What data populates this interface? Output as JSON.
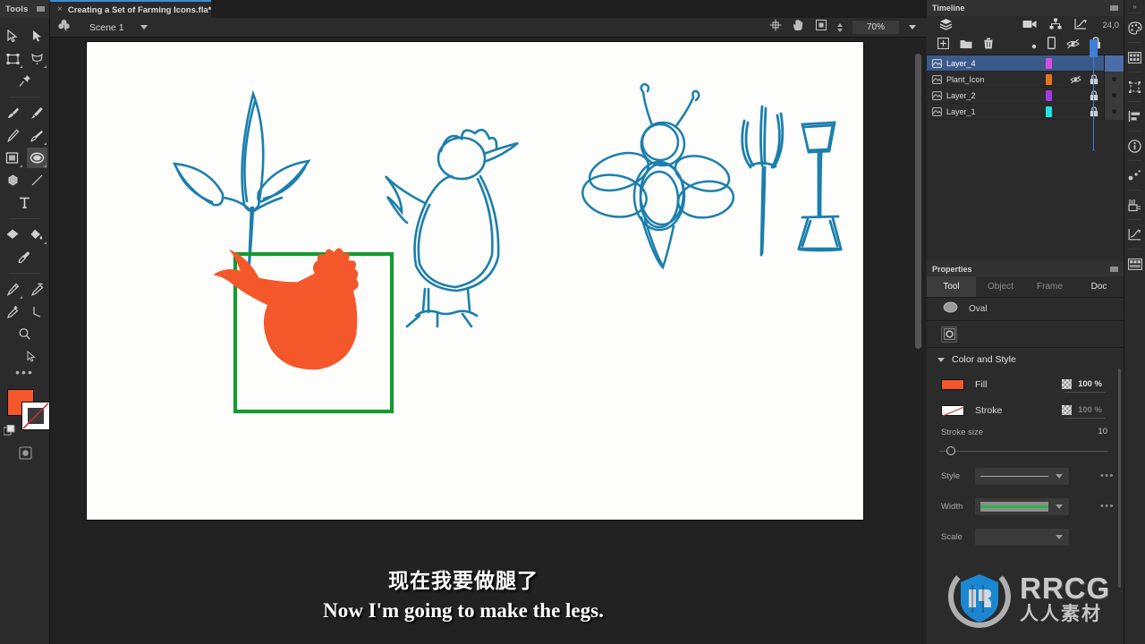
{
  "tools": {
    "title": "Tools",
    "menu_icon": "panel-menu-icon",
    "items": [
      {
        "name": "selection-tool",
        "icon": "arrow-outline-icon"
      },
      {
        "name": "subselection-tool",
        "icon": "arrow-filled-icon"
      },
      {
        "name": "free-transform-tool",
        "icon": "free-transform-icon"
      },
      {
        "name": "lasso-tool",
        "icon": "lasso-icon"
      },
      {
        "name": "pin-tool",
        "icon": "pin-icon"
      },
      {
        "name": "brush-tool",
        "icon": "paint-brush-icon"
      },
      {
        "name": "paint-brush-tool",
        "icon": "brush-icon"
      },
      {
        "name": "pencil-tool",
        "icon": "pencil-icon"
      },
      {
        "name": "fluid-brush-tool",
        "icon": "fluid-brush-icon"
      },
      {
        "name": "rectangle-tool",
        "icon": "rectangle-icon"
      },
      {
        "name": "oval-tool",
        "icon": "oval-icon"
      },
      {
        "name": "polystar-tool",
        "icon": "polygon-icon"
      },
      {
        "name": "line-tool",
        "icon": "line-icon"
      },
      {
        "name": "text-tool",
        "icon": "text-t-icon"
      },
      {
        "name": "eraser-tool",
        "icon": "eraser-icon"
      },
      {
        "name": "paint-bucket-tool",
        "icon": "paint-bucket-icon"
      },
      {
        "name": "eyedropper-tool",
        "icon": "eyedropper-icon"
      },
      {
        "name": "pen-tool",
        "icon": "pen-icon"
      },
      {
        "name": "delete-anchor-tool",
        "icon": "pen-minus-icon"
      },
      {
        "name": "add-anchor-tool",
        "icon": "pen-plus-icon"
      },
      {
        "name": "convert-anchor-tool",
        "icon": "convert-anchor-icon"
      },
      {
        "name": "zoom-tool",
        "icon": "magnifier-icon"
      },
      {
        "name": "hand-cursor-tool",
        "icon": "cursor-arrow-icon"
      }
    ],
    "more_label": "•••",
    "fill_color": "#f4572a",
    "stroke_color": "#ffffff"
  },
  "document_tab": {
    "close_label": "×",
    "title": "Creating a Set of Farming Icons.fla*"
  },
  "doc_toolbar": {
    "edit_symbol_icon": "clover-icon",
    "scene_label": "Scene 1",
    "scene_chevron": "chevron-down-icon",
    "center_stage_icon": "center-stage-icon",
    "hand_icon": "hand-icon",
    "clip_content_icon": "clip-content-icon",
    "zoom_value": "70%",
    "zoom_chevron": "chevron-down-icon"
  },
  "stage": {
    "sketches": [
      {
        "name": "plant-sketch",
        "color": "#1b7fad"
      },
      {
        "name": "chicken-sketch",
        "color": "#1b7fad"
      },
      {
        "name": "bee-sketch",
        "color": "#1b7fad"
      },
      {
        "name": "pitchfork-sketch",
        "color": "#1b7fad"
      },
      {
        "name": "shovel-sketch",
        "color": "#1b7fad"
      }
    ],
    "selected_shape": {
      "name": "chicken-body-shape",
      "fill": "#f4572a",
      "selection_box_color": "#149b32"
    }
  },
  "subtitles": {
    "chinese": "现在我要做腿了",
    "english": "Now I'm going to make the legs."
  },
  "timeline": {
    "title": "Timeline",
    "menu_icon": "panel-menu-icon",
    "toolbar_icons": [
      {
        "name": "layer-depth-icon",
        "icon": "layers-stack-icon"
      },
      {
        "name": "camera-icon",
        "icon": "video-camera-icon"
      },
      {
        "name": "layer-parenting-icon",
        "icon": "hierarchy-icon"
      },
      {
        "name": "graph-editor-icon",
        "icon": "line-graph-icon"
      }
    ],
    "frame_number": "24,0",
    "layer_tools": [
      {
        "name": "new-layer-button",
        "icon": "plus-square-icon"
      },
      {
        "name": "new-folder-button",
        "icon": "folder-icon"
      },
      {
        "name": "delete-layer-button",
        "icon": "trash-icon"
      },
      {
        "name": "layer-dot-header",
        "icon": "dot-icon"
      },
      {
        "name": "outline-column-header",
        "icon": "rectangle-outline-icon"
      },
      {
        "name": "visibility-column-header",
        "icon": "eye-slash-icon"
      },
      {
        "name": "lock-column-header",
        "icon": "lock-icon"
      }
    ],
    "layers": [
      {
        "name": "Layer_4",
        "chip": "#d84fe0",
        "active": true,
        "hidden": false,
        "locked": false
      },
      {
        "name": "Plant_Icon",
        "chip": "#e8721c",
        "active": false,
        "hidden": true,
        "locked": true
      },
      {
        "name": "Layer_2",
        "chip": "#a23ae0",
        "active": false,
        "hidden": false,
        "locked": true
      },
      {
        "name": "Layer_1",
        "chip": "#22e3e3",
        "active": false,
        "hidden": false,
        "locked": true
      }
    ],
    "playhead_color": "#3f7fd4"
  },
  "properties": {
    "title": "Properties",
    "menu_icon": "panel-menu-icon",
    "tabs": [
      {
        "label": "Tool",
        "selected": true,
        "enabled": true
      },
      {
        "label": "Object",
        "selected": false,
        "enabled": false
      },
      {
        "label": "Frame",
        "selected": false,
        "enabled": false
      },
      {
        "label": "Doc",
        "selected": false,
        "enabled": true
      }
    ],
    "tool_icon": "oval-icon",
    "tool_name": "Oval",
    "object_drawing_icon": "object-drawing-icon",
    "section": {
      "expand_icon": "chevron-down-icon",
      "title": "Color and Style",
      "fill": {
        "label": "Fill",
        "color": "#f4572a",
        "alpha": "100 %",
        "alpha_dim": false,
        "checker_icon": "transparency-checker-icon"
      },
      "stroke": {
        "label": "Stroke",
        "color": "#ffffff",
        "alpha": "100 %",
        "alpha_dim": true,
        "checker_icon": "transparency-checker-icon"
      },
      "stroke_size": {
        "label": "Stroke size",
        "value": "10"
      },
      "style": {
        "label": "Style",
        "preview": "solid-line-preview",
        "chevron": "chevron-down-icon",
        "more": "•••"
      },
      "width": {
        "label": "Width",
        "preview": "width-profile-preview",
        "preview_color": "#2bb34a",
        "chevron": "chevron-down-icon",
        "more": "•••"
      },
      "scale": {
        "label": "Scale",
        "chevron": "chevron-down-icon"
      }
    }
  },
  "icon_rail": {
    "collapse_icon": "double-chevron-icon",
    "items": [
      {
        "name": "color-palette-icon"
      },
      {
        "name": "swatches-icon"
      },
      {
        "name": "transform-icon"
      },
      {
        "name": "align-icon"
      },
      {
        "name": "info-icon"
      },
      {
        "name": "motion-path-icon"
      },
      {
        "name": "asset-warp-icon"
      },
      {
        "name": "graph-editor-icon"
      },
      {
        "name": "library-icon"
      }
    ]
  },
  "watermark": {
    "brand": "RRCG",
    "chinese": "人人素材",
    "logo_icon": "rrcg-shield-logo-icon",
    "accent": "#1a8fe0"
  }
}
